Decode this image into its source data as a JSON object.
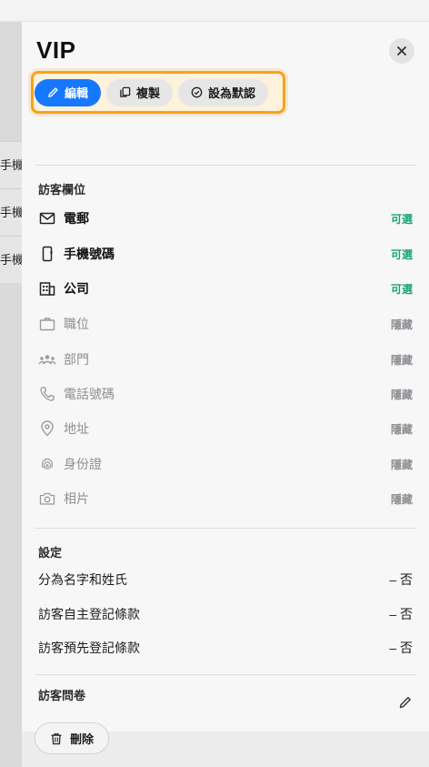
{
  "background": {
    "rows": [
      {
        "label": "手機號"
      },
      {
        "label": "手機號"
      },
      {
        "label": "手機號"
      }
    ]
  },
  "panel": {
    "title": "VIP",
    "toolbar": {
      "edit_label": "編輯",
      "copy_label": "複製",
      "default_label": "設為默認"
    },
    "visitor_fields": {
      "section_title": "訪客欄位",
      "items": [
        {
          "label": "電郵",
          "status": "可選",
          "icon": "mail-icon"
        },
        {
          "label": "手機號碼",
          "status": "可選",
          "icon": "mobile-icon"
        },
        {
          "label": "公司",
          "status": "可選",
          "icon": "building-icon"
        },
        {
          "label": "職位",
          "status": "隱藏",
          "icon": "briefcase-icon"
        },
        {
          "label": "部門",
          "status": "隱藏",
          "icon": "people-icon"
        },
        {
          "label": "電話號碼",
          "status": "隱藏",
          "icon": "phone-icon"
        },
        {
          "label": "地址",
          "status": "隱藏",
          "icon": "location-pin-icon"
        },
        {
          "label": "身份證",
          "status": "隱藏",
          "icon": "fingerprint-icon"
        },
        {
          "label": "相片",
          "status": "隱藏",
          "icon": "camera-icon"
        }
      ]
    },
    "settings": {
      "section_title": "設定",
      "items": [
        {
          "label": "分為名字和姓氏",
          "value": "– 否"
        },
        {
          "label": "訪客自主登記條款",
          "value": "– 否"
        },
        {
          "label": "訪客預先登記條款",
          "value": "– 否"
        }
      ]
    },
    "questionnaire": {
      "section_title": "訪客問卷"
    },
    "delete_label": "刪除"
  },
  "colors": {
    "primary": "#1677ff",
    "highlight": "#f5a31a",
    "enabled_status": "#1aa37a",
    "disabled": "#8e8e93"
  }
}
